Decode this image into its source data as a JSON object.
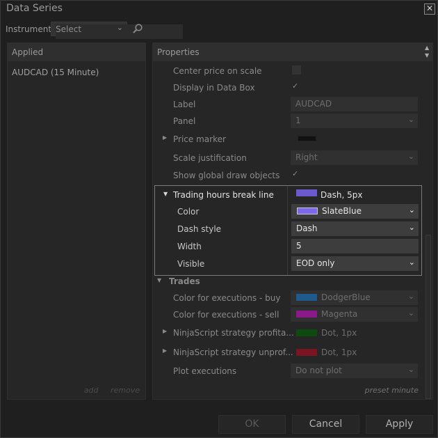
{
  "window": {
    "title": "Data Series",
    "close_glyph": "✕"
  },
  "instrument": {
    "label": "Instrument",
    "select_value": "Select"
  },
  "applied": {
    "header": "Applied",
    "items": [
      "AUDCAD (15 Minute)"
    ],
    "add": "add",
    "remove": "remove"
  },
  "properties": {
    "header": "Properties",
    "preset": "preset minute",
    "rows": [
      {
        "label": "Center price on scale",
        "type": "checkbox",
        "checked": false
      },
      {
        "label": "Display in Data Box",
        "type": "checkbox",
        "checked": true,
        "mark": "✓"
      },
      {
        "label": "Label",
        "type": "text",
        "value": "AUDCAD"
      },
      {
        "label": "Panel",
        "type": "dropdown",
        "value": "1"
      },
      {
        "label": "Price marker",
        "type": "swatch",
        "color": "#111111"
      },
      {
        "label": "Scale justification",
        "type": "dropdown",
        "value": "Right"
      },
      {
        "label": "Show global draw objects",
        "type": "checkbox",
        "checked": true,
        "mark": "✓"
      }
    ],
    "trading_hours": {
      "label": "Trading hours break line",
      "summary": "Dash, 5px",
      "summary_color": "#6a5acd",
      "color_label": "Color",
      "color_value": "SlateBlue",
      "color_hex": "#7b68ee",
      "dash_label": "Dash style",
      "dash_value": "Dash",
      "width_label": "Width",
      "width_value": "5",
      "visible_label": "Visible",
      "visible_value": "EOD only"
    },
    "trades": {
      "category": "Trades",
      "rows": [
        {
          "label": "Color for executions - buy",
          "value": "DodgerBlue",
          "color": "#1e5a8c"
        },
        {
          "label": "Color for executions - sell",
          "value": "Magenta",
          "color": "#8a1a8a"
        },
        {
          "label": "NinjaScript strategy profita...",
          "value": "Dot, 1px",
          "color": "#0e4a0e"
        },
        {
          "label": "NinjaScript strategy unprof...",
          "value": "Dot, 1px",
          "color": "#7a1420"
        },
        {
          "label": "Plot executions",
          "value": "Do not plot"
        }
      ]
    }
  },
  "buttons": {
    "ok": "OK",
    "cancel": "Cancel",
    "apply": "Apply"
  }
}
